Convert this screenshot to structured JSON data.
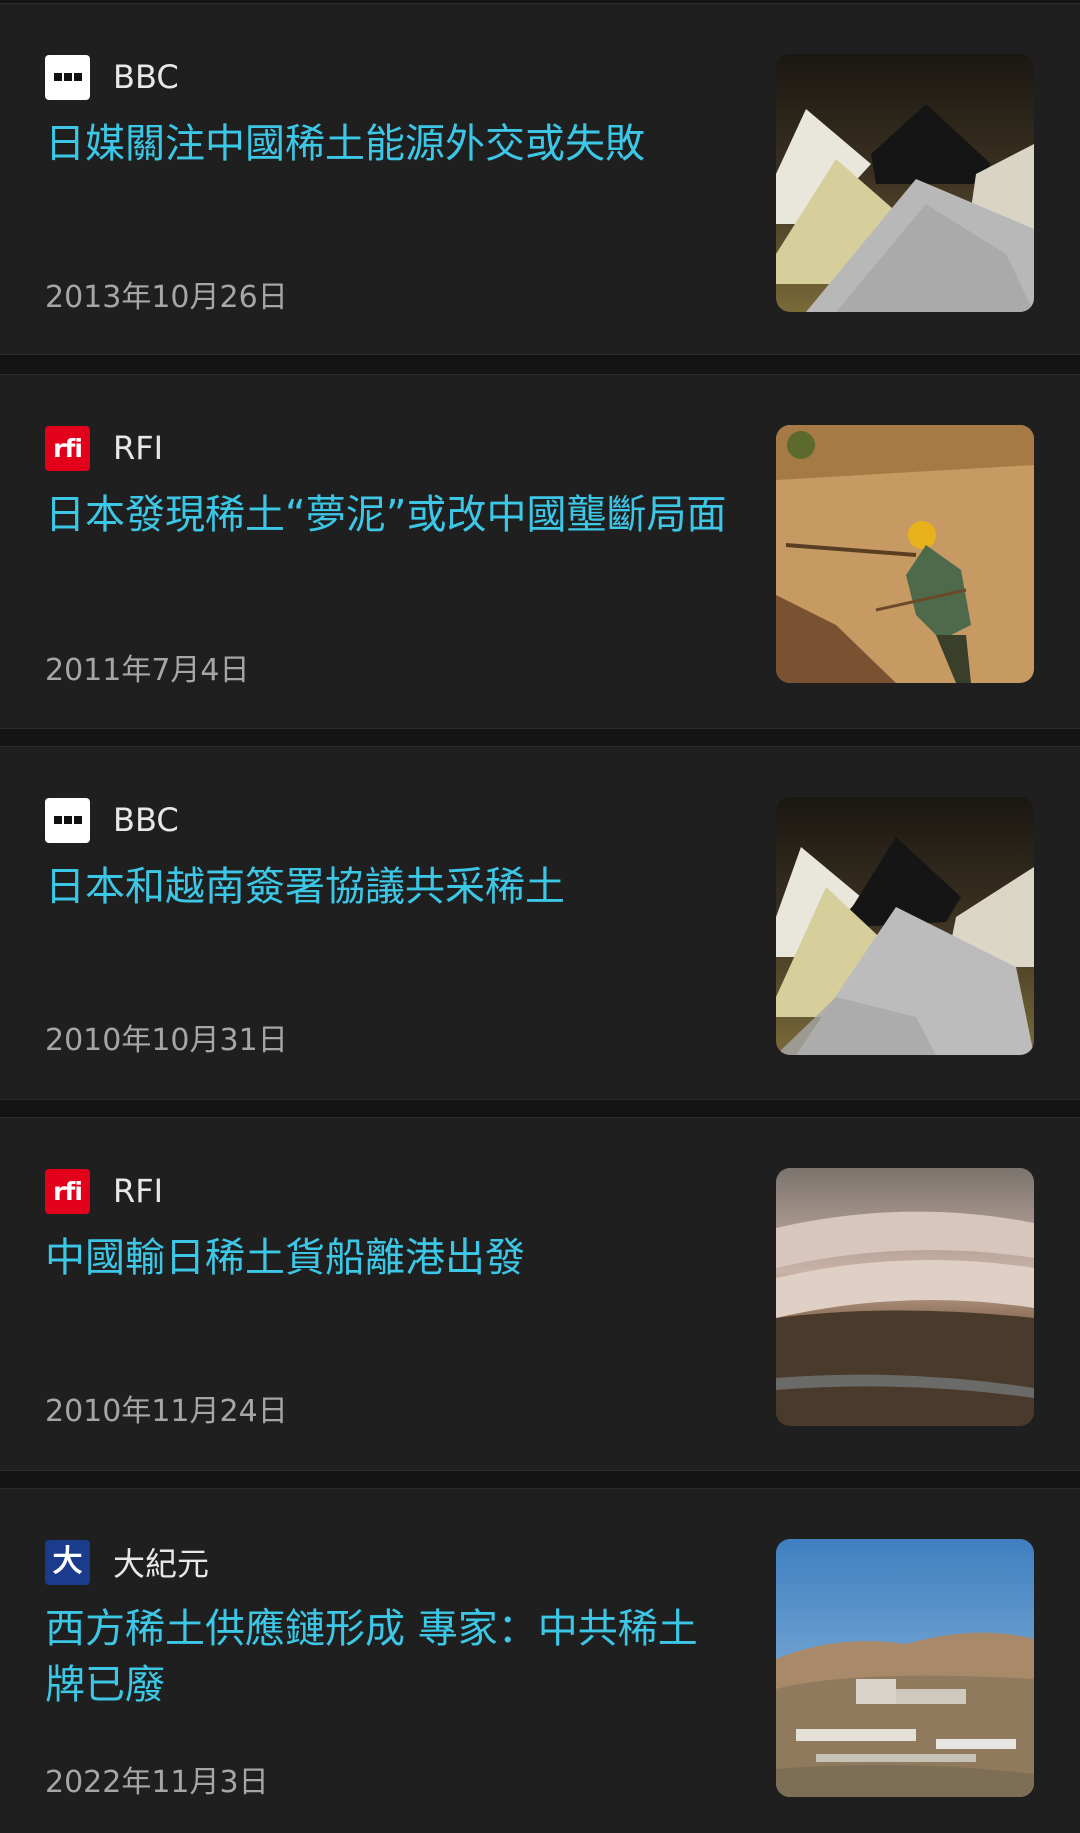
{
  "articles": [
    {
      "source": "BBC",
      "source_logo": "bbc-logo",
      "headline": "日媒關注中國稀土能源外交或失敗",
      "date": "2013年10月26日",
      "thumbnail": "rare-earth-powder-piles-photo"
    },
    {
      "source": "RFI",
      "source_logo": "rfi-logo",
      "headline": "日本發現稀土“夢泥”或改中國壟斷局面",
      "date": "2011年7月4日",
      "thumbnail": "worker-in-rare-earth-mine-photo"
    },
    {
      "source": "BBC",
      "source_logo": "bbc-logo",
      "headline": "日本和越南簽署協議共采稀土",
      "date": "2010年10月31日",
      "thumbnail": "rare-earth-powder-piles-photo"
    },
    {
      "source": "RFI",
      "source_logo": "rfi-logo",
      "headline": "中國輸日稀土貨船離港出發",
      "date": "2010年11月24日",
      "thumbnail": "open-pit-mine-photo"
    },
    {
      "source": "大紀元",
      "source_logo": "dajiyuan-logo",
      "headline": "西方稀土供應鏈形成 專家：中共稀土牌已廢",
      "date": "2022年11月3日",
      "thumbnail": "mining-facility-landscape-photo"
    }
  ],
  "colors": {
    "page_background": "#141414",
    "card_background": "#1f1f1f",
    "headline": "#3cc7e6",
    "source_text": "#e8e8e8",
    "date_text": "#a6a6a6",
    "rfi_red": "#e2001a",
    "dajiyuan_blue": "#1b3c8c"
  }
}
